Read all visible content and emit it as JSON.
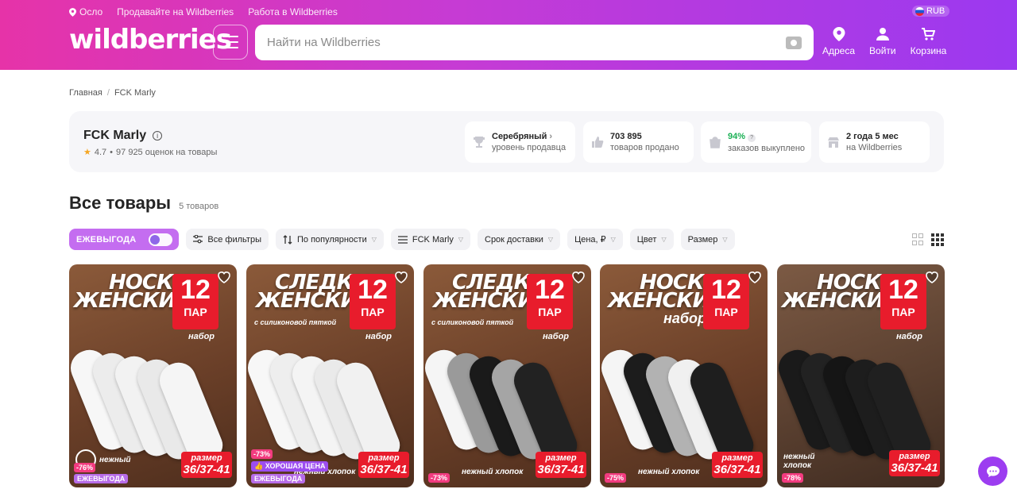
{
  "topbar": {
    "location": "Осло",
    "sell": "Продавайте на Wildberries",
    "work": "Работа в Wildberries",
    "currency": "RUB"
  },
  "header": {
    "logo": "wildberries",
    "search_placeholder": "Найти на Wildberries",
    "nav": {
      "addresses": "Адреса",
      "login": "Войти",
      "cart": "Корзина"
    }
  },
  "breadcrumb": {
    "home": "Главная",
    "current": "FCK Marly"
  },
  "seller": {
    "name": "FCK Marly",
    "rating": "4.7",
    "reviews": "97 925 оценок на товары",
    "stats": [
      {
        "value": "Серебряный",
        "label": "уровень продавца"
      },
      {
        "value": "703 895",
        "label": "товаров продано"
      },
      {
        "value": "94%",
        "label": "заказов выкуплено"
      },
      {
        "value": "2 года 5 мес",
        "label": "на Wildberries"
      }
    ]
  },
  "section": {
    "title": "Все товары",
    "count": "5 товаров"
  },
  "filters": {
    "promo": "ЕЖЕВЫГОДА",
    "all": "Все фильтры",
    "sort": "По популярности",
    "brand": "FCK Marly",
    "delivery": "Срок доставки",
    "price": "Цена, ₽",
    "color": "Цвет",
    "size": "Размер"
  },
  "products": [
    {
      "headline_1": "НОСКИ",
      "headline_2": "ЖЕНСКИЕ",
      "pack_n": "12",
      "pack_u": "ПАР",
      "set": "набор",
      "size_label": "размер",
      "size": "36/37-41",
      "cotton": "нежный",
      "discount": "-76%",
      "promo": "ЕЖЕВЫГОДА",
      "colors": [
        "#f7f7f7",
        "#ececec",
        "#f2f2f2",
        "#e9e9e9",
        "#f5f5f5"
      ]
    },
    {
      "headline_1": "СЛЕДКИ",
      "headline_2": "ЖЕНСКИЕ",
      "subline": "с силиконовой пяткой",
      "pack_n": "12",
      "pack_u": "ПАР",
      "set": "набор",
      "size_label": "размер",
      "size": "36/37-41",
      "cotton": "нежный хлопок",
      "discount": "-73%",
      "good": "ХОРОШАЯ ЦЕНА",
      "promo": "ЕЖЕВЫГОДА",
      "colors": [
        "#f7f7f7",
        "#eeeeee",
        "#f4f4f4",
        "#eaeaea",
        "#f1f1f1"
      ]
    },
    {
      "headline_1": "СЛЕДКИ",
      "headline_2": "ЖЕНСКИЕ",
      "subline": "с силиконовой пяткой",
      "pack_n": "12",
      "pack_u": "ПАР",
      "set": "набор",
      "size_label": "размер",
      "size": "36/37-41",
      "cotton": "нежный хлопок",
      "discount": "-73%",
      "colors": [
        "#f5f5f5",
        "#9a9a9a",
        "#1a1a1a",
        "#a5a5a5",
        "#222222"
      ]
    },
    {
      "headline_1": "НОСКИ",
      "headline_2": "ЖЕНСКИЕ",
      "subline_big": "набор",
      "pack_n": "12",
      "pack_u": "ПАР",
      "size_label": "размер",
      "size": "36/37-41",
      "cotton": "нежный хлопок",
      "discount": "-75%",
      "colors": [
        "#f5f5f5",
        "#1c1c1c",
        "#b2b2b2",
        "#f0f0f0",
        "#1e1e1e"
      ]
    },
    {
      "headline_1": "НОСКИ",
      "headline_2": "ЖЕНСКИЕ",
      "pack_n": "12",
      "pack_u": "ПАР",
      "set": "набор",
      "size_label": "размер",
      "size": "36/37-41",
      "cotton": "нежный хлопок",
      "discount": "-78%",
      "colors": [
        "#1a1a1a",
        "#222222",
        "#151515",
        "#1d1d1d",
        "#202020"
      ]
    }
  ]
}
